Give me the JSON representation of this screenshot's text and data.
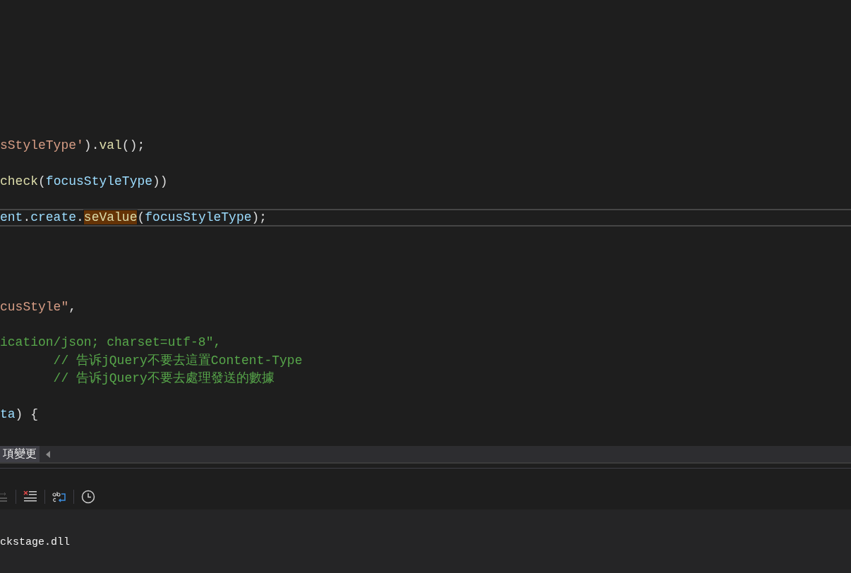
{
  "editor": {
    "lines": [
      {
        "current": false,
        "tokens": [
          {
            "text": "sStyleType'",
            "kind": "string"
          },
          {
            "text": ").",
            "kind": "punct"
          },
          {
            "text": "val",
            "kind": "method"
          },
          {
            "text": "();",
            "kind": "punct"
          }
        ]
      },
      {
        "current": false
      },
      {
        "current": false,
        "tokens": [
          {
            "text": "check",
            "kind": "method"
          },
          {
            "text": "(",
            "kind": "punct"
          },
          {
            "text": "focusStyleType",
            "kind": "var"
          },
          {
            "text": "))",
            "kind": "punct"
          }
        ]
      },
      {
        "current": false
      },
      {
        "current": true,
        "tokens": [
          {
            "text": "ent",
            "kind": "var"
          },
          {
            "text": ".",
            "kind": "punct"
          },
          {
            "text": "create",
            "kind": "var"
          },
          {
            "text": ".",
            "kind": "punct"
          },
          {
            "text": "seValue",
            "kind": "match"
          },
          {
            "text": "(",
            "kind": "punct"
          },
          {
            "text": "focusStyleType",
            "kind": "var"
          },
          {
            "text": ");",
            "kind": "punct"
          }
        ]
      },
      {
        "current": false
      },
      {
        "current": false
      },
      {
        "current": false
      },
      {
        "current": false
      },
      {
        "current": false,
        "tokens": [
          {
            "text": "cusStyle\"",
            "kind": "string"
          },
          {
            "text": ",",
            "kind": "punct"
          }
        ]
      },
      {
        "current": false
      },
      {
        "current": false,
        "tokens": [
          {
            "text": "ication/json; charset=utf-8\",",
            "kind": "comment"
          }
        ]
      },
      {
        "current": false,
        "tokens": [
          {
            "text": "       // 告诉jQuery不要去這置Content-Type",
            "kind": "comment"
          }
        ]
      },
      {
        "current": false,
        "tokens": [
          {
            "text": "       // 告诉jQuery不要去處理發送的數據",
            "kind": "comment"
          }
        ]
      },
      {
        "current": false
      },
      {
        "current": false,
        "tokens": [
          {
            "text": "ta",
            "kind": "var"
          },
          {
            "text": ") {",
            "kind": "punct"
          }
        ]
      }
    ]
  },
  "doc_tabs": [
    {
      "label": "項變更",
      "selected": true
    }
  ],
  "output": {
    "lines": [
      "ckstage.dll"
    ]
  }
}
